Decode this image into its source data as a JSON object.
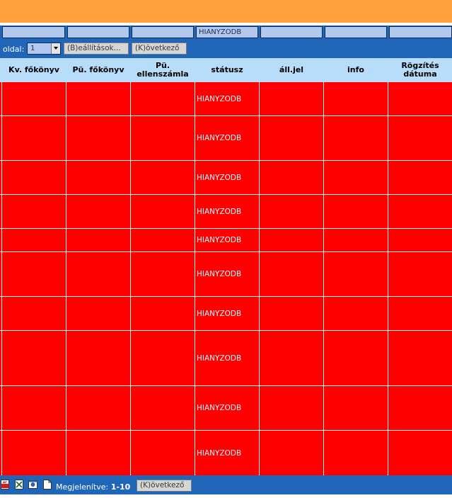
{
  "filters": {
    "status_value": "HIANYZODB"
  },
  "pager": {
    "label": "oldal:",
    "page_value": "1",
    "settings_label": "(B)eállítások...",
    "next_label": "(K)övetkező"
  },
  "columns": [
    "Kv. főkönyv",
    "Pü. főkönyv",
    "Pü. ellenszámla",
    "státusz",
    "áll.jel",
    "info",
    "Rögzítés dátuma"
  ],
  "rows": [
    {
      "status": "HIANYZODB"
    },
    {
      "status": "HIANYZODB"
    },
    {
      "status": "HIANYZODB"
    },
    {
      "status": "HIANYZODB"
    },
    {
      "status": "HIANYZODB"
    },
    {
      "status": "HIANYZODB"
    },
    {
      "status": "HIANYZODB"
    },
    {
      "status": "HIANYZODB"
    },
    {
      "status": "HIANYZODB"
    },
    {
      "status": "HIANYZODB"
    }
  ],
  "footer": {
    "shown_label": "Megjelenítve:",
    "shown_range": "1-10",
    "next_label": "(K)övetkező",
    "icons": [
      "pdf-icon",
      "excel-icon",
      "outlook-icon",
      "blank-document-icon"
    ]
  },
  "colors": {
    "topbar": "#ff9f3a",
    "toolbar": "#1f66b8",
    "header": "#b7ddfa",
    "row_missing": "#ff0000"
  }
}
